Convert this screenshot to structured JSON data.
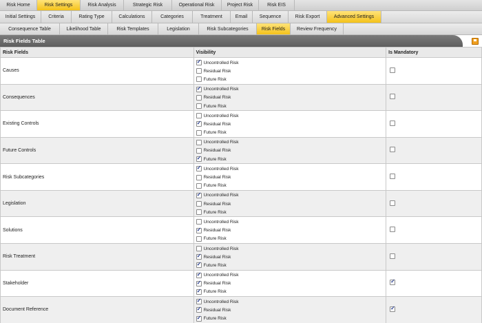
{
  "nav_main": [
    {
      "label": "Risk Home",
      "active": false
    },
    {
      "label": "Risk Settings",
      "active": true
    },
    {
      "label": "Risk Analysis",
      "active": false
    },
    {
      "label": "Strategic Risk",
      "active": false
    },
    {
      "label": "Operational Risk",
      "active": false
    },
    {
      "label": "Project Risk",
      "active": false
    },
    {
      "label": "Risk EIS",
      "active": false
    }
  ],
  "nav_settings": [
    {
      "label": "Initial Settings",
      "active": false
    },
    {
      "label": "Criteria",
      "active": false
    },
    {
      "label": "Rating Type",
      "active": false
    },
    {
      "label": "Calculations",
      "active": false
    },
    {
      "label": "Categories",
      "active": false
    },
    {
      "label": "Treatment",
      "active": false
    },
    {
      "label": "Email",
      "active": false
    },
    {
      "label": "Sequence",
      "active": false
    },
    {
      "label": "Risk Export",
      "active": false
    },
    {
      "label": "Advanced Settings",
      "active": true
    }
  ],
  "nav_advanced": [
    {
      "label": "Consequence Table",
      "active": false
    },
    {
      "label": "Likelihood Table",
      "active": false
    },
    {
      "label": "Risk Templates",
      "active": false
    },
    {
      "label": "Legislation",
      "active": false
    },
    {
      "label": "Risk Subcategories",
      "active": false
    },
    {
      "label": "Risk Fields",
      "active": true
    },
    {
      "label": "Review Frequency",
      "active": false
    }
  ],
  "panel": {
    "title": "Risk Fields Table",
    "save_icon": "save-icon"
  },
  "table": {
    "headers": {
      "field": "Risk Fields",
      "visibility": "Visibility",
      "mandatory": "Is Mandatory"
    },
    "options": [
      "Uncontrolled Risk",
      "Residual Risk",
      "Future Risk"
    ],
    "rows": [
      {
        "name": "Causes",
        "visibility": [
          true,
          false,
          false
        ],
        "mandatory": false
      },
      {
        "name": "Consequences",
        "visibility": [
          true,
          false,
          false
        ],
        "mandatory": false
      },
      {
        "name": "Existing Controls",
        "visibility": [
          false,
          true,
          false
        ],
        "mandatory": false
      },
      {
        "name": "Future Controls",
        "visibility": [
          false,
          false,
          true
        ],
        "mandatory": false
      },
      {
        "name": "Risk Subcategories",
        "visibility": [
          true,
          false,
          false
        ],
        "mandatory": false
      },
      {
        "name": "Legislation",
        "visibility": [
          true,
          false,
          false
        ],
        "mandatory": false
      },
      {
        "name": "Solutions",
        "visibility": [
          false,
          true,
          false
        ],
        "mandatory": false
      },
      {
        "name": "Risk Treatment",
        "visibility": [
          false,
          true,
          true
        ],
        "mandatory": false
      },
      {
        "name": "Stakeholder",
        "visibility": [
          true,
          true,
          true
        ],
        "mandatory": true
      },
      {
        "name": "Document Reference",
        "visibility": [
          true,
          true,
          true
        ],
        "mandatory": true
      }
    ]
  },
  "colors": {
    "active_tab": "#f4c21a",
    "title_bar": "#6b6b6b",
    "check": "#2a3f8f"
  }
}
